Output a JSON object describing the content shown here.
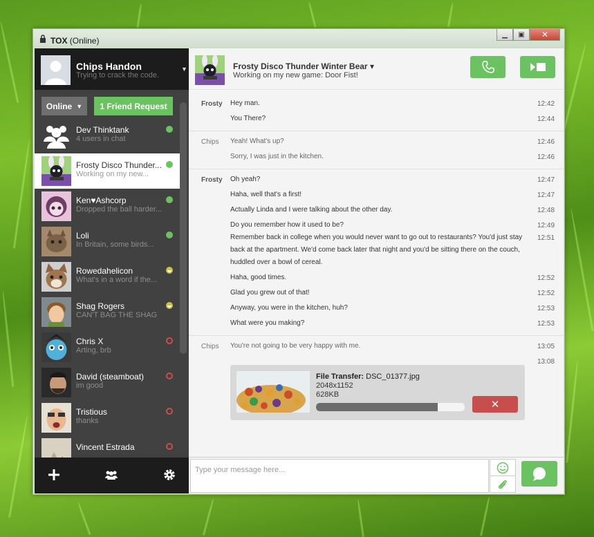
{
  "window": {
    "title": "TOX",
    "title_suffix": " (Online)",
    "controls": [
      "minimize",
      "maximize",
      "close"
    ]
  },
  "self": {
    "name": "Chips Handon",
    "status_message": "Trying to crack the code."
  },
  "sidebar": {
    "status_select": "Online",
    "friend_request_label": "1 Friend Request",
    "friends": [
      {
        "name": "Dev Thinktank",
        "status": "4 users in chat",
        "presence": "online",
        "icon": "group-icon"
      },
      {
        "name": "Frosty Disco Thunder...",
        "status": "Working on my new...",
        "presence": "online",
        "active": true
      },
      {
        "name": "Ken♥Ashcorp",
        "status": "Dropped the ball harder...",
        "presence": "online"
      },
      {
        "name": "Loli",
        "status": "In Britain, some birds...",
        "presence": "online"
      },
      {
        "name": "Rowedahelicon",
        "status": "What's in a word if the...",
        "presence": "away"
      },
      {
        "name": "Shag Rogers",
        "status": "CAN'T BAG THE SHAG",
        "presence": "away"
      },
      {
        "name": "Chris X",
        "status": "Arting, brb",
        "presence": "offline"
      },
      {
        "name": "David (steamboat)",
        "status": "im good",
        "presence": "offline"
      },
      {
        "name": "Tristious",
        "status": "thanks",
        "presence": "offline"
      },
      {
        "name": "Vincent Estrada",
        "status": "",
        "presence": "offline"
      }
    ],
    "bottom_buttons": [
      "add-friend-icon",
      "groups-icon",
      "settings-icon"
    ]
  },
  "chat": {
    "contact_name": "Frosty Disco Thunder Winter Bear",
    "contact_name_caret": "▾",
    "contact_status": "Working on my new game: Door Fist!",
    "messages": [
      {
        "author": "Frosty",
        "text": "Hey man.",
        "time": "12:42"
      },
      {
        "author": "",
        "text": "You There?",
        "time": "12:44"
      },
      {
        "author": "Chips",
        "text": "Yeah! What's up?",
        "time": "12:46"
      },
      {
        "author": "",
        "text": "Sorry, I was just in the kitchen.",
        "time": "12:46"
      },
      {
        "author": "Frosty",
        "text": "Oh yeah?",
        "time": "12:47"
      },
      {
        "author": "",
        "text": "Haha, well that's a first!",
        "time": "12:47"
      },
      {
        "author": "",
        "text": "Actually Linda and I were talking about the other day.",
        "time": "12:48"
      },
      {
        "author": "",
        "text": "Do you remember how it used to be?",
        "time": "12:49"
      },
      {
        "author": "",
        "text": "Remember back in college when you would never want to go out to restaurants? You'd just stay back at the apartment. We'd come back later that night and you'd be sitting there on the couch, huddled over a bowl of cereal.",
        "time": "12:51"
      },
      {
        "author": "",
        "text": "Haha, good times.",
        "time": "12:52"
      },
      {
        "author": "",
        "text": "Glad you grew out of that!",
        "time": "12:52"
      },
      {
        "author": "",
        "text": "Anyway, you were in the kitchen, huh?",
        "time": "12:53"
      },
      {
        "author": "",
        "text": "What were you making?",
        "time": "12:53"
      },
      {
        "author": "Chips",
        "text": "You're not going to be very happy with me.",
        "time": "13:05"
      },
      {
        "author": "",
        "text": "",
        "time": "13:08"
      }
    ],
    "file_transfer": {
      "title_label": "File Transfer:",
      "filename": "DSC_01377.jpg",
      "dimensions": "2048x1152",
      "size": "628KB",
      "progress_percent": 82,
      "cancel_icon": "✕"
    },
    "composer": {
      "placeholder": "Type your message here..."
    }
  },
  "colors": {
    "accent_green": "#6bc260",
    "danger_red": "#c84e4e",
    "away_yellow": "#cebf45",
    "dark": "#1c1c1c",
    "sidebar": "#414141"
  }
}
